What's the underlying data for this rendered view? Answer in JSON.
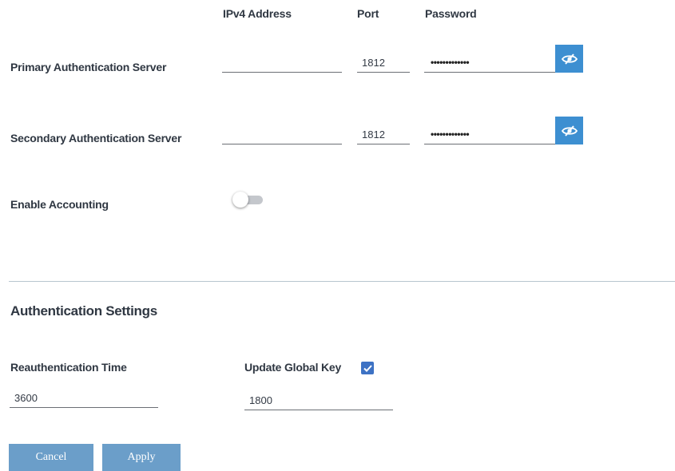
{
  "columns": {
    "ipv4": "IPv4 Address",
    "port": "Port",
    "password": "Password"
  },
  "servers": [
    {
      "label": "Primary Authentication Server",
      "ipv4": "",
      "port": "1812",
      "password_mask": "•••••••••••••"
    },
    {
      "label": "Secondary Authentication Server",
      "ipv4": "",
      "port": "1812",
      "password_mask": "•••••••••••••"
    }
  ],
  "accounting": {
    "label": "Enable Accounting",
    "enabled": false
  },
  "auth_settings": {
    "title": "Authentication Settings",
    "reauth_label": "Reauthentication Time",
    "reauth_value": "3600",
    "global_key_label": "Update Global Key",
    "global_key_checked": true,
    "global_key_value": "1800"
  },
  "buttons": {
    "cancel": "Cancel",
    "apply": "Apply"
  },
  "colors": {
    "accent": "#3d8fd1",
    "button": "#6b9ec9",
    "checkbox": "#3d72c4",
    "divider": "#b8c6cf"
  },
  "icons": {
    "password_toggle": "eye-slash-icon",
    "checkbox": "checkmark-icon"
  }
}
